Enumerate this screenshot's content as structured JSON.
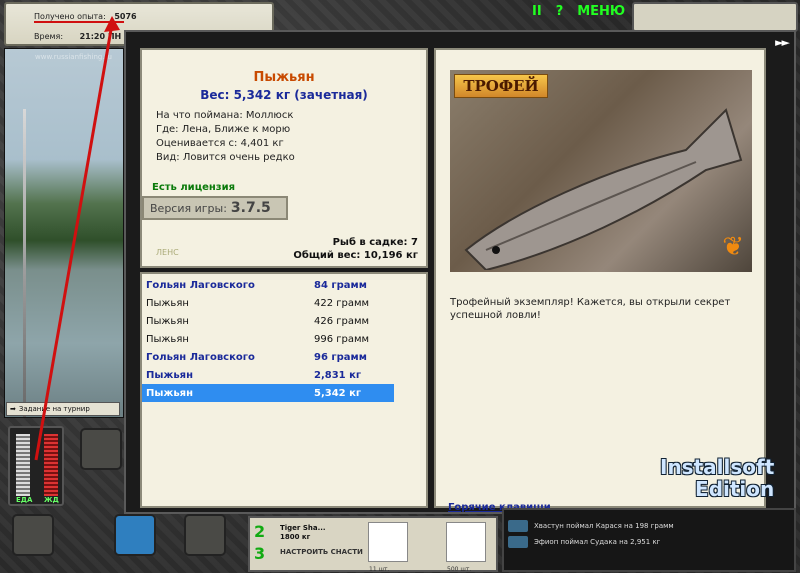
{
  "header": {
    "xp_label": "Получено опыта:",
    "xp_value": "5076",
    "time_label": "Время:",
    "time_value": "21:20 ПН"
  },
  "controls": {
    "pause": "II",
    "help": "?",
    "menu": "МЕНЮ",
    "close": "►►"
  },
  "scene": {
    "watermark": "www.russianfishing.ru",
    "tournament_task": "Задание на турнир"
  },
  "meters": {
    "food_label": "ЕДА",
    "hp_label": "ЖД"
  },
  "fish_card": {
    "name": "Пыжьян",
    "weight": "Вес: 5,342 кг (зачетная)",
    "bait": "На что поймана: Моллюск",
    "location": "Где: Лена, Ближе к морю",
    "price": "Оценивается с: 4,401 кг",
    "species": "Вид: Ловится очень редко",
    "license": "Есть лицензия",
    "version_label": "Версия игры:",
    "version_value": "3.7.5",
    "logo_text": "ЛЕНС",
    "fish_in_keepnet": "Рыб в садке: 7",
    "total_weight": "Общий вес: 10,196 кг"
  },
  "catch_list": [
    {
      "name": "Гольян Лаговского",
      "weight": "84 грамм",
      "bold": true,
      "selected": false
    },
    {
      "name": "Пыжьян",
      "weight": "422 грамм",
      "bold": false,
      "selected": false
    },
    {
      "name": "Пыжьян",
      "weight": "426 грамм",
      "bold": false,
      "selected": false
    },
    {
      "name": "Пыжьян",
      "weight": "996 грамм",
      "bold": false,
      "selected": false
    },
    {
      "name": "Гольян Лаговского",
      "weight": "96 грамм",
      "bold": true,
      "selected": false
    },
    {
      "name": "Пыжьян",
      "weight": "2,831 кг",
      "bold": true,
      "selected": false
    },
    {
      "name": "Пыжьян",
      "weight": "5,342 кг",
      "bold": true,
      "selected": true
    }
  ],
  "trophy": {
    "badge": "ТРОФЕЙ",
    "text": "Трофейный экземпляр! Кажется, вы открыли секрет успешной ловли!",
    "hotkeys": "Горячие клавиши"
  },
  "bottom": {
    "num2": "2",
    "num3": "3",
    "rod_name": "Tiger Sha...",
    "rod_weight": "1800 кг",
    "setup_label": "НАСТРОИТЬ СНАСТИ",
    "slot1_count": "11 шт.",
    "slot2_count": "500 шт."
  },
  "news": [
    "Хвастун поймал Карася на 198 грамм",
    "Эфиоп поймал Судака на 2,951 кг"
  ],
  "brand": {
    "line1": "Installsoft",
    "line2": "Edition"
  },
  "colors": {
    "fish_name": "#c84a00",
    "highlight_blue": "#1a2a9a",
    "selection": "#2f8df0",
    "license_green": "#0a7a0a",
    "annotation_red": "#d01010"
  }
}
